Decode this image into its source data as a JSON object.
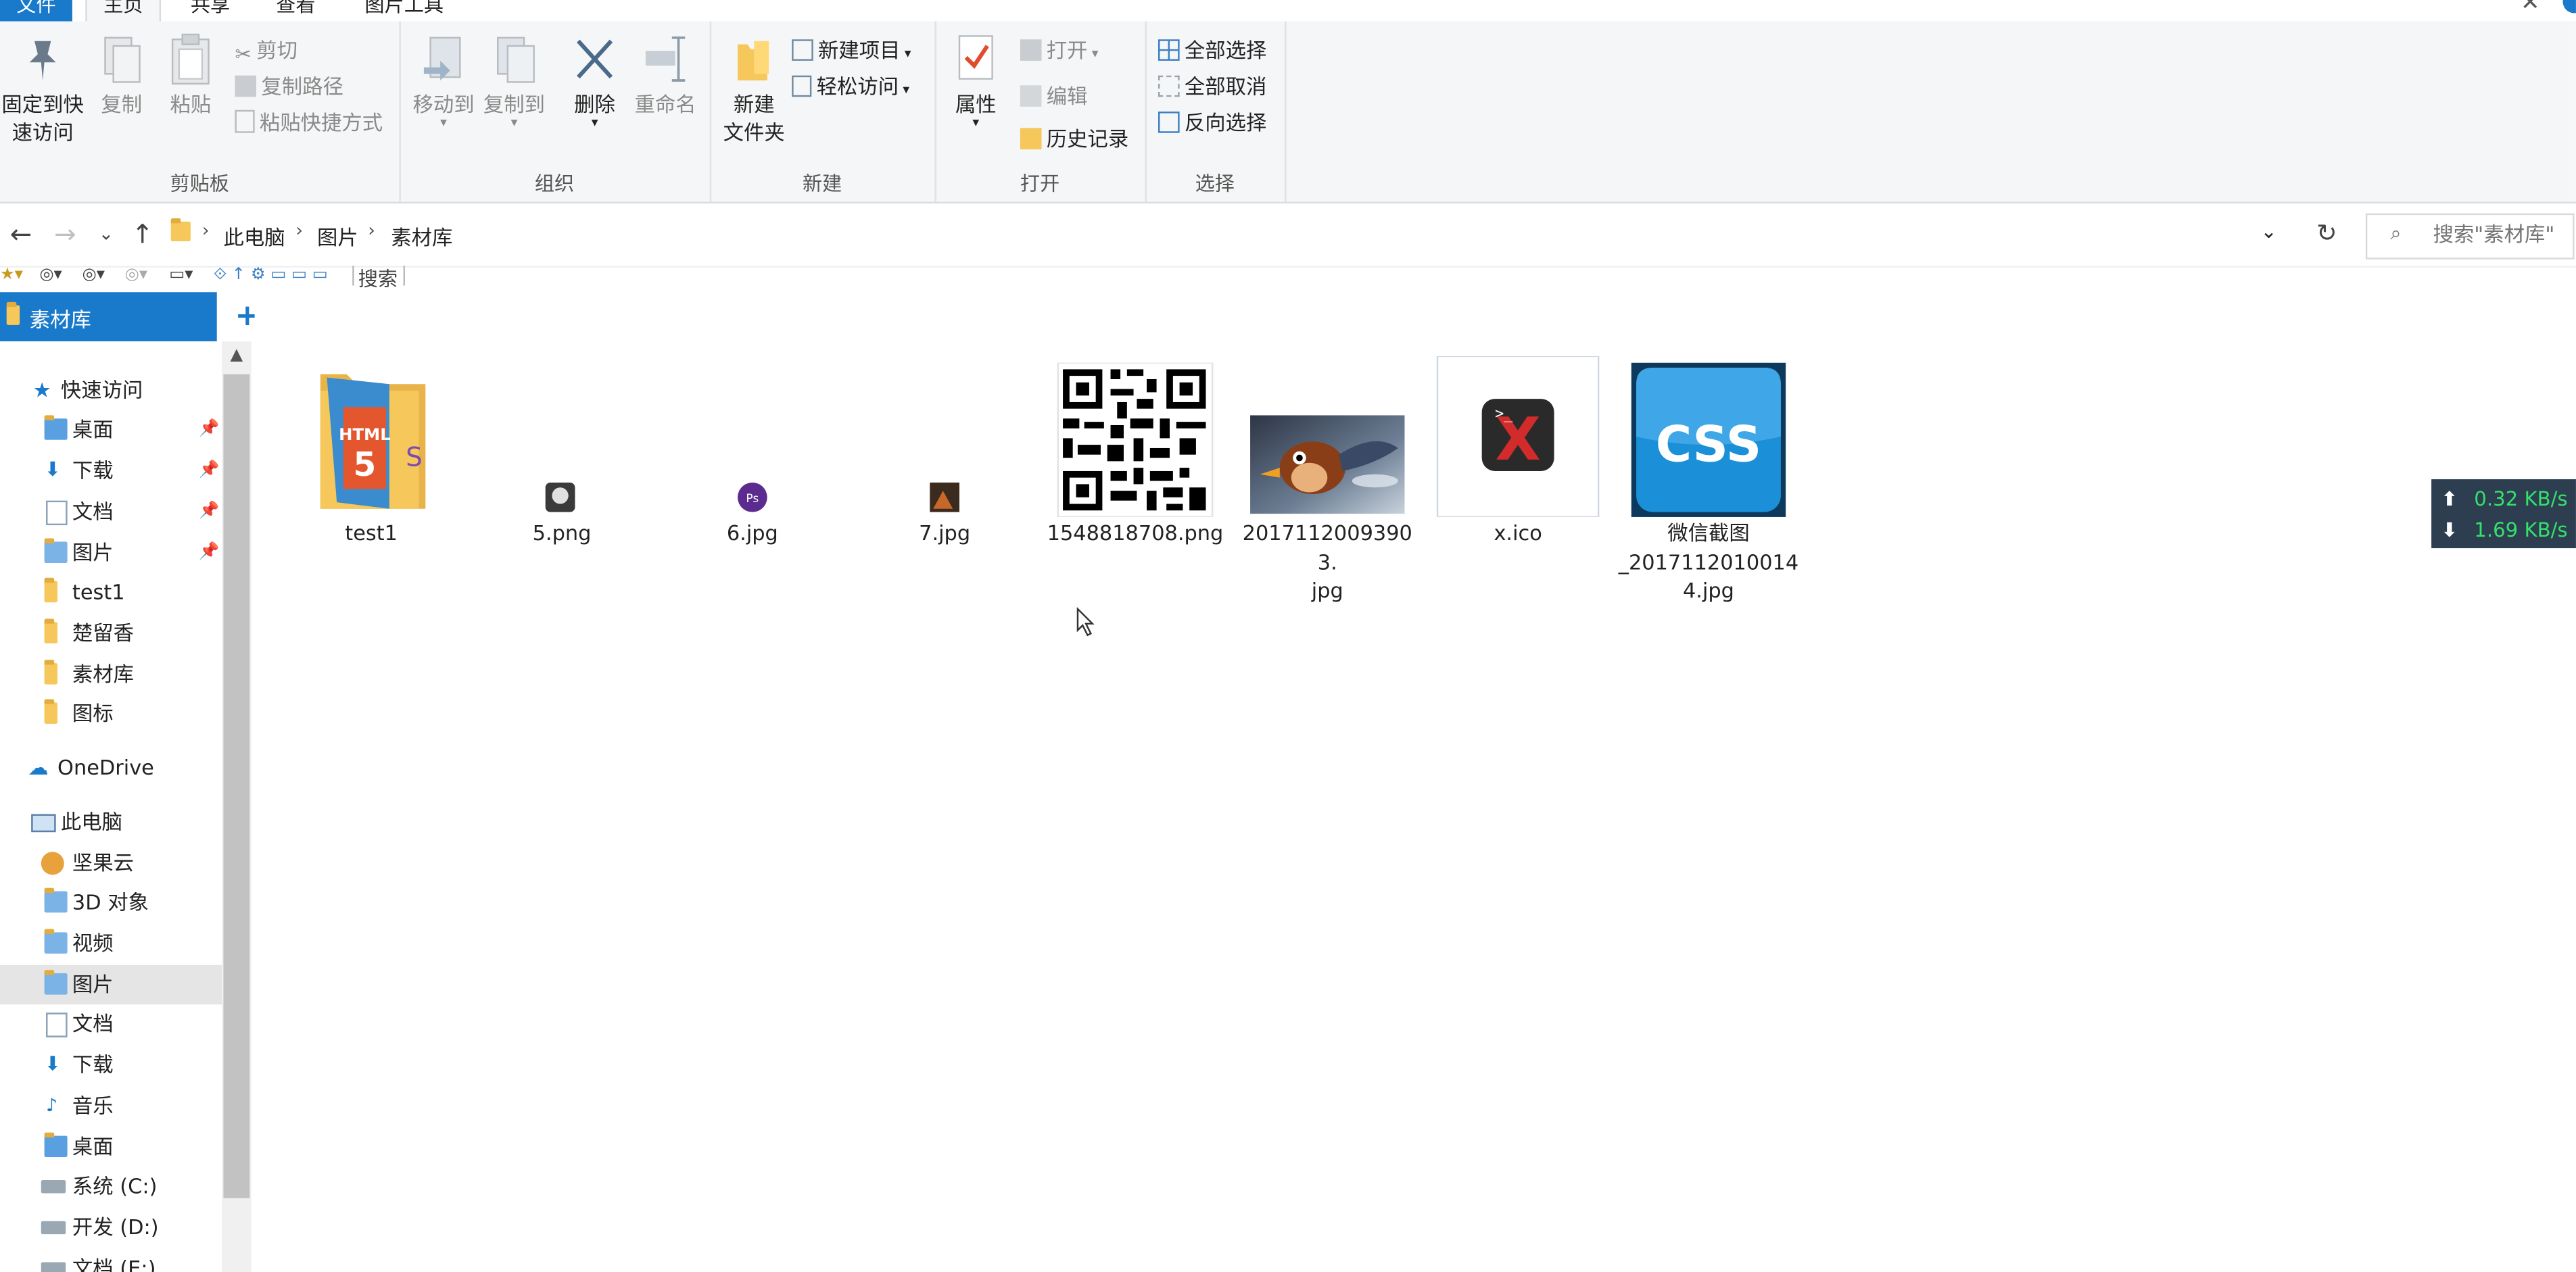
{
  "ribbon_tabs": {
    "file": "文件",
    "home": "主页",
    "share": "共享",
    "view": "查看",
    "picture_tools": "图片工具"
  },
  "ribbon": {
    "clipboard": {
      "label": "剪贴板",
      "pin": "固定到快速访问",
      "pin_line1": "固定到快",
      "pin_line2": "速访问",
      "copy": "复制",
      "paste": "粘贴",
      "cut": "剪切",
      "copy_path": "复制路径",
      "paste_shortcut": "粘贴快捷方式"
    },
    "organize": {
      "label": "组织",
      "move_to": "移动到",
      "copy_to": "复制到",
      "delete": "删除",
      "rename": "重命名"
    },
    "new": {
      "label": "新建",
      "new_folder_line1": "新建",
      "new_folder_line2": "文件夹",
      "new_item": "新建项目",
      "easy_access": "轻松访问"
    },
    "open": {
      "label": "打开",
      "properties": "属性",
      "open": "打开",
      "edit": "编辑",
      "history": "历史记录"
    },
    "select": {
      "label": "选择",
      "select_all": "全部选择",
      "select_none": "全部取消",
      "invert": "反向选择"
    }
  },
  "address": {
    "crumbs": [
      "此电脑",
      "图片",
      "素材库"
    ],
    "search_placeholder": "搜索\"素材库\""
  },
  "tinybar": {
    "search": "搜索"
  },
  "nav": {
    "header": "素材库",
    "quick_access": "快速访问",
    "quick_items": [
      {
        "label": "桌面",
        "pinned": true
      },
      {
        "label": "下载",
        "pinned": true
      },
      {
        "label": "文档",
        "pinned": true
      },
      {
        "label": "图片",
        "pinned": true
      },
      {
        "label": "test1",
        "pinned": false
      },
      {
        "label": "楚留香",
        "pinned": false
      },
      {
        "label": "素材库",
        "pinned": false
      },
      {
        "label": "图标",
        "pinned": false
      }
    ],
    "onedrive": "OneDrive",
    "this_pc": "此电脑",
    "pc_items": [
      "坚果云",
      "3D 对象",
      "视频",
      "图片",
      "文档",
      "下载",
      "音乐",
      "桌面",
      "系统 (C:)",
      "开发 (D:)",
      "文档 (E:)"
    ],
    "selected": "图片"
  },
  "files": [
    {
      "name": "test1",
      "icon": "folder-html5-icon"
    },
    {
      "name": "5.png",
      "icon": "small-image-icon"
    },
    {
      "name": "6.jpg",
      "icon": "photoshop-image-icon"
    },
    {
      "name": "7.jpg",
      "icon": "small-photo-icon"
    },
    {
      "name": "1548818708.png",
      "icon": "qr-code-thumbnail"
    },
    {
      "name": "20171120093903.jpg",
      "name_line1": "20171120093903.",
      "name_line2": "jpg",
      "icon": "bird-photo-thumbnail"
    },
    {
      "name": "x.ico",
      "icon": "terminal-x-icon"
    },
    {
      "name": "微信截图_20171120100144.jpg",
      "name_line1": "微信截图",
      "name_line2": "_2017112010014",
      "name_line3": "4.jpg",
      "icon": "css-logo-thumbnail"
    }
  ],
  "netmon": {
    "up": "0.32 KB/s",
    "down": "1.69 KB/s"
  },
  "colors": {
    "accent": "#1979ca",
    "ribbon_bg": "#f5f6f7",
    "selected_row": "#e5e5e5",
    "netmon_bg": "#2c3e50",
    "netmon_text": "#35e06b"
  }
}
